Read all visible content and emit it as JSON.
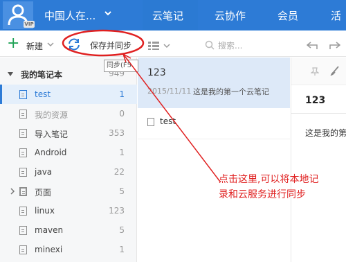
{
  "header": {
    "user_name": "中国人在...",
    "vip_badge": "VIP",
    "tabs": [
      {
        "label": "云笔记"
      },
      {
        "label": "云协作"
      },
      {
        "label": "会员"
      },
      {
        "label": "活"
      }
    ]
  },
  "toolbar": {
    "new_label": "新建",
    "sync_label": "保存并同步",
    "search_placeholder": "搜索..."
  },
  "tooltip": "同步(F5",
  "sidebar": {
    "title": "我的笔记本",
    "total": "949",
    "items": [
      {
        "name": "test",
        "count": "1"
      },
      {
        "name": "我的资源",
        "count": "0"
      },
      {
        "name": "导入笔记",
        "count": "353"
      },
      {
        "name": "Android",
        "count": "1"
      },
      {
        "name": "java",
        "count": "22"
      },
      {
        "name": "页面",
        "count": "5"
      },
      {
        "name": "linux",
        "count": "123"
      },
      {
        "name": "maven",
        "count": "5"
      },
      {
        "name": "minexi",
        "count": "1"
      }
    ]
  },
  "notes": [
    {
      "title": "123",
      "date": "2015/11/11",
      "snippet": "这是我的第一个云笔记"
    },
    {
      "title": "test"
    }
  ],
  "editor": {
    "title": "123",
    "body": "这是我的第"
  },
  "annotation": {
    "line1": "点击这里,可以将本地记",
    "line2": "录和云服务进行同步"
  },
  "colors": {
    "brand": "#2d7bd6",
    "annotation": "#e02020",
    "new_plus": "#21a357"
  }
}
